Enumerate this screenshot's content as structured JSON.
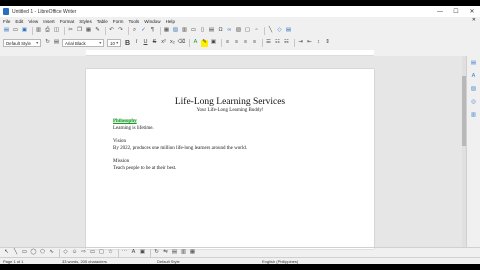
{
  "window": {
    "title": "Untitled 1 - LibreOffice Writer"
  },
  "window_controls": {
    "minimize": "—",
    "maximize": "☐",
    "close": "✕"
  },
  "menu": [
    "File",
    "Edit",
    "View",
    "Insert",
    "Format",
    "Styles",
    "Table",
    "Form",
    "Tools",
    "Window",
    "Help"
  ],
  "menu_close": "✕",
  "toolbar": {
    "paragraph_style": "Default Style",
    "font_name": "Arial Black",
    "font_size": "10"
  },
  "document": {
    "title": "Life-Long Learning Services",
    "subtitle": "Your Life-Long Learning Buddy!",
    "philosophy_heading": "Philosophy",
    "philosophy_text": "Learning is lifetime.",
    "vision_heading": "Vision",
    "vision_text": "By 2022, produces one million life-long learners around the world.",
    "mission_heading": "Mission",
    "mission_text": "Teach people to be at their best."
  },
  "status": {
    "page": "Page 1 of 1",
    "word_count": "33 words, 205 characters",
    "page_style": "Default Style",
    "language": "English (Philippines)"
  },
  "colors": {
    "accent": "#2a6fbf",
    "heading_highlight": "#1a9b2f"
  },
  "icons": {
    "toolbar1": [
      "new-document-icon",
      "open-icon",
      "save-icon",
      "export-pdf-icon",
      "print-icon",
      "print-preview-icon",
      "cut-icon",
      "copy-icon",
      "paste-icon",
      "clone-formatting-icon",
      "undo-icon",
      "redo-icon",
      "find-replace-icon",
      "spelling-icon",
      "formatting-marks-icon",
      "table-icon",
      "image-icon",
      "chart-icon",
      "text-box-icon",
      "page-break-icon",
      "field-icon",
      "special-character-icon",
      "hyperlink-icon",
      "footnote-icon",
      "comment-icon",
      "track-changes-icon",
      "line-icon",
      "shapes-icon"
    ],
    "sidebar": [
      "properties-icon",
      "styles-icon",
      "gallery-icon",
      "navigator-icon",
      "manage-changes-icon"
    ]
  }
}
